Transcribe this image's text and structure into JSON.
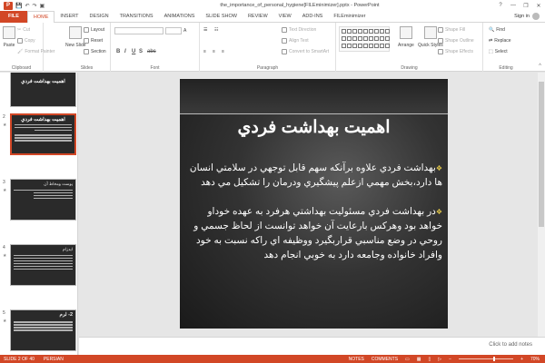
{
  "window": {
    "title": "the_importance_of_personal_hygiene[FILEminimizer].pptx - PowerPoint",
    "app_icon": "P",
    "controls": [
      "?",
      "—",
      "❐",
      "✕"
    ]
  },
  "tabs": [
    {
      "label": "FILE"
    },
    {
      "label": "HOME"
    },
    {
      "label": "INSERT"
    },
    {
      "label": "DESIGN"
    },
    {
      "label": "TRANSITIONS"
    },
    {
      "label": "ANIMATIONS"
    },
    {
      "label": "SLIDE SHOW"
    },
    {
      "label": "REVIEW"
    },
    {
      "label": "VIEW"
    },
    {
      "label": "ADD-INS"
    },
    {
      "label": "FILEminimizer"
    }
  ],
  "signin": "Sign in",
  "ribbon": {
    "clipboard": {
      "label": "Clipboard",
      "paste": "Paste",
      "cut": "Cut",
      "copy": "Copy",
      "format_painter": "Format Painter"
    },
    "slides": {
      "label": "Slides",
      "new_slide": "New Slide",
      "layout": "Layout",
      "reset": "Reset",
      "section": "Section"
    },
    "font": {
      "label": "Font",
      "bold": "B",
      "italic": "I",
      "underline": "U",
      "shadow": "S",
      "strike": "abc"
    },
    "paragraph": {
      "label": "Paragraph",
      "text_direction": "Text Direction",
      "align_text": "Align Text",
      "smartart": "Convert to SmartArt"
    },
    "drawing": {
      "label": "Drawing",
      "arrange": "Arrange",
      "quick_styles": "Quick Styles",
      "shape_fill": "Shape Fill",
      "shape_outline": "Shape Outline",
      "shape_effects": "Shape Effects"
    },
    "editing": {
      "label": "Editing",
      "find": "Find",
      "replace": "Replace",
      "select": "Select"
    }
  },
  "thumbnails": [
    {
      "num": "",
      "title": "اهمیت بهداشت فردي"
    },
    {
      "num": "2",
      "title": "اهمیت بهداشت فردي"
    },
    {
      "num": "3",
      "title": "پوست ومخاط آن"
    },
    {
      "num": "4",
      "title": "ایدزام"
    },
    {
      "num": "5",
      "title": "2- لرم"
    }
  ],
  "slide": {
    "title": "اهمیت بهداشت فردي",
    "bullets": [
      "بهداشت فردي علاوه برآنكه سهم قابل توجهي در سلامتي انسان ها دارد،بخش مهمي ازعلم پيشگيري ودرمان را تشكيل مي دهد",
      "در بهداشت فردي مسئوليت بهداشتي هرفرد به عهده خوداو خواهد بود وهركس بارعايت آن خواهد توانست از لحاظ جسمي و روحي در وضع مناسبي قراربگيرد ووظيفه اي راكه نسبت به خود وافراد خانواده وجامعه دارد به خوبي انجام دهد"
    ]
  },
  "notes_placeholder": "Click to add notes",
  "status": {
    "slide": "SLIDE 2 OF 40",
    "language": "PERSIAN",
    "notes": "NOTES",
    "comments": "COMMENTS",
    "zoom": "70%"
  },
  "colors": {
    "accent": "#d24726",
    "bullet": "#e3c84a"
  }
}
